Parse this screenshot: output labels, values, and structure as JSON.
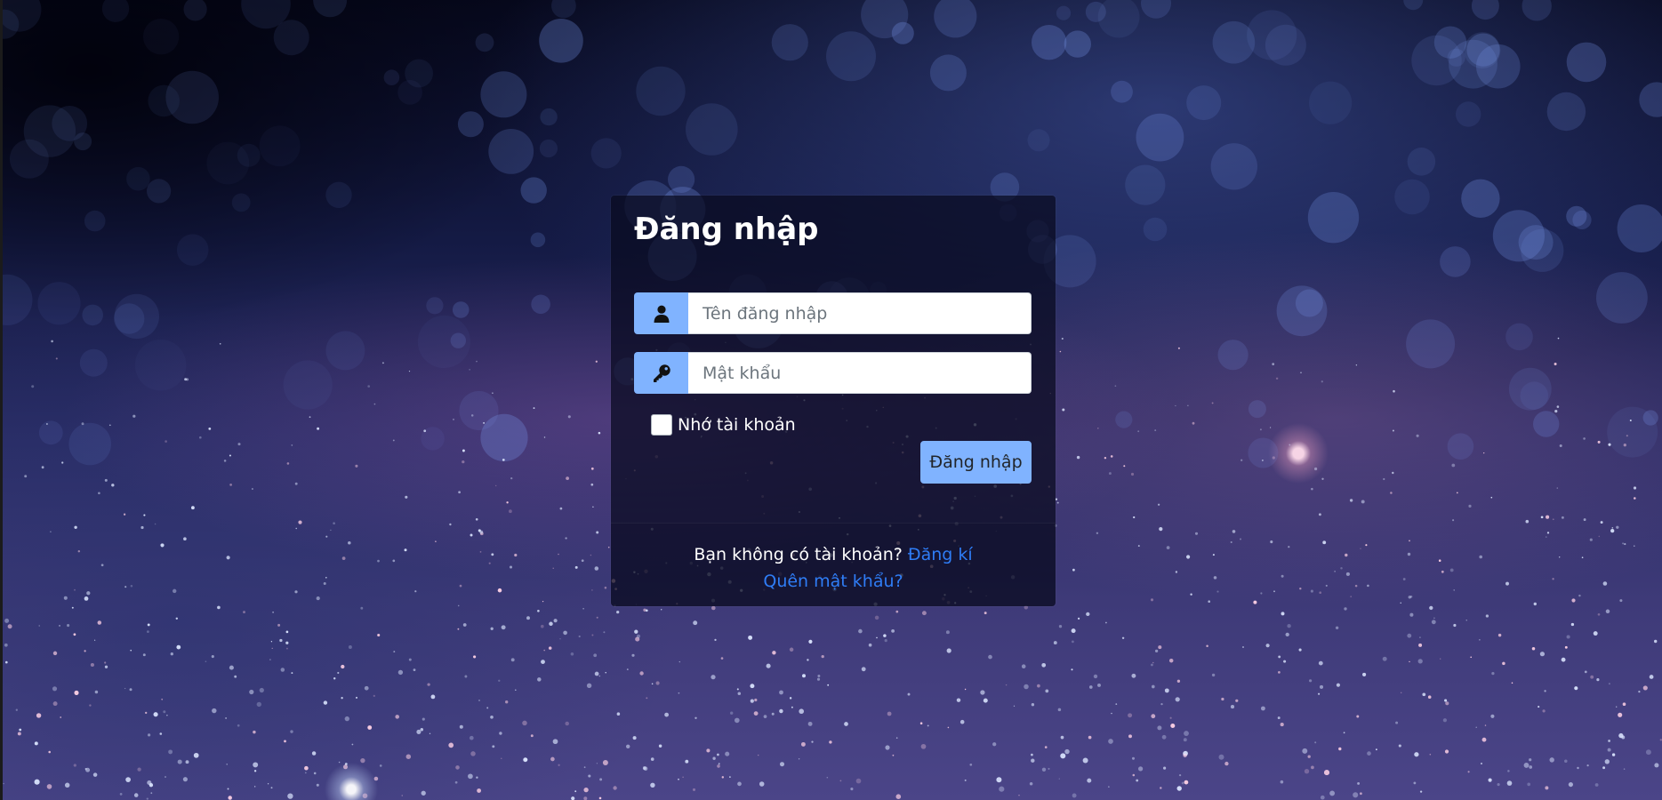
{
  "background": {
    "description_icon": "night-sky-bokeh-background"
  },
  "login": {
    "title": "Đăng nhập",
    "username_placeholder": "Tên đăng nhập",
    "username_value": "",
    "username_icon": "user-icon",
    "password_placeholder": "Mật khẩu",
    "password_value": "",
    "password_icon": "key-icon",
    "remember_label": "Nhớ tài khoản",
    "remember_checked": false,
    "submit_label": "Đăng nhập",
    "accent_color": "#80b3ff",
    "link_color": "#2f7df6"
  },
  "footer": {
    "no_account_text": "Bạn không có tài khoản?",
    "register_link": "Đăng kí",
    "forgot_password_link": "Quên mật khẩu?"
  }
}
